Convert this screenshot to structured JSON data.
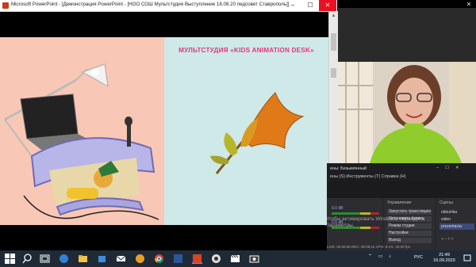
{
  "powerpoint": {
    "title": "Microsoft PowerPoint - [Демонстрация PowerPoint - [НОО СОШ Мультстудия Выступление 18.08.20 педсовет Ставрополь]]",
    "buttons": {
      "minimize": "–",
      "maximize": "☐",
      "close": "✕"
    }
  },
  "slide": {
    "title": "МУЛЬТСТУДИЯ «KIDS ANIMATION DESK»",
    "colors": {
      "left_bg": "#f9c7b5",
      "right_bg": "#cfe8e8",
      "title": "#e23a7b"
    }
  },
  "webcam": {
    "close": "✕"
  },
  "obs": {
    "window_title": "ены: Безымянный",
    "menu": "ены (S)   Инструменты (T)   Справка (H)",
    "mixer": [
      {
        "label": "0.0 dB"
      },
      {
        "label": "0.0 dB"
      }
    ],
    "controls_header": "Управление",
    "buttons": [
      "Запустить трансляцию",
      "Остановить запись",
      "Режим студии",
      "Настройки",
      "Выход"
    ],
    "scenes_header": "Сцены",
    "scenes": [
      "oblozhka",
      "video",
      "prezentacia"
    ],
    "scene_tools": "+  –  ˄  ˅",
    "status": "LIVE: 00:00:00   REC: 00:09:15   CPU: 8.1%, 30.00 fps"
  },
  "watermark": {
    "line1": "Чтобы активировать Windows, перейдите",
    "line2": "Параметры."
  },
  "taskbar": {
    "time": "21:49",
    "date": "16.09.2020",
    "lang": "РУС",
    "tray": "⌃ ▭ ♪"
  }
}
